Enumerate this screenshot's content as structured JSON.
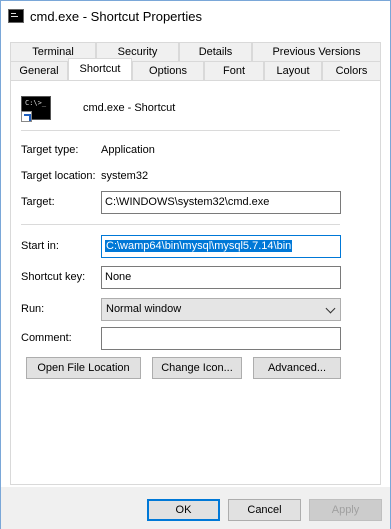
{
  "window": {
    "title": "cmd.exe - Shortcut Properties"
  },
  "tabs": {
    "row1": [
      "Terminal",
      "Security",
      "Details",
      "Previous Versions"
    ],
    "row2": [
      "General",
      "Shortcut",
      "Options",
      "Font",
      "Layout",
      "Colors"
    ],
    "active": "Shortcut"
  },
  "header": {
    "name": "cmd.exe - Shortcut",
    "icon": "cmd-shortcut-icon"
  },
  "fields": {
    "target_type_label": "Target type:",
    "target_type_value": "Application",
    "target_location_label": "Target location:",
    "target_location_value": "system32",
    "target_label": "Target:",
    "target_value": "C:\\WINDOWS\\system32\\cmd.exe",
    "start_in_label": "Start in:",
    "start_in_value": "C:\\wamp64\\bin\\mysql\\mysql5.7.14\\bin",
    "shortcut_key_label": "Shortcut key:",
    "shortcut_key_value": "None",
    "run_label": "Run:",
    "run_value": "Normal window",
    "comment_label": "Comment:",
    "comment_value": ""
  },
  "actions": {
    "open_location": "Open File Location",
    "change_icon": "Change Icon...",
    "advanced": "Advanced..."
  },
  "footer": {
    "ok": "OK",
    "cancel": "Cancel",
    "apply": "Apply"
  },
  "colors": {
    "accent": "#0078d7",
    "selection": "#0078d7",
    "window_border": "#7aa7d8"
  }
}
